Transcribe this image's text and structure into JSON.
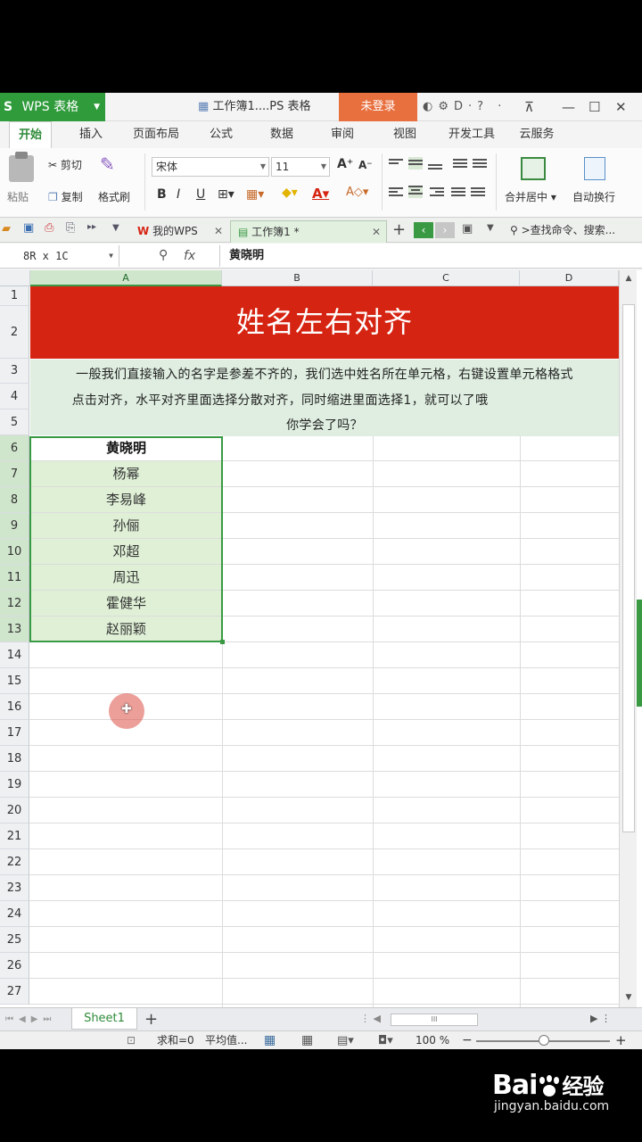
{
  "titlebar": {
    "app_logo": "S",
    "app_name": "WPS 表格",
    "doc_title": "工作簿1....PS 表格",
    "login": "未登录",
    "icons": [
      "skin-icon",
      "gear-icon",
      "cloud-icon",
      "help-icon"
    ],
    "help_text": "? ·"
  },
  "menu": {
    "tabs": [
      "开始",
      "插入",
      "页面布局",
      "公式",
      "数据",
      "审阅",
      "视图",
      "开发工具",
      "云服务"
    ]
  },
  "ribbon": {
    "paste": "粘贴",
    "cut": "剪切",
    "copy": "复制",
    "format_painter": "格式刷",
    "font_name": "宋体",
    "font_size": "11",
    "grow_font": "A⁺",
    "shrink_font": "A⁻",
    "bold": "B",
    "italic": "I",
    "underline": "U",
    "merge_center": "合并居中",
    "auto_wrap": "自动换行"
  },
  "tabbar": {
    "my_wps": "我的WPS",
    "workbook": "工作簿1 *",
    "search": "查找命令、搜索..."
  },
  "formula_bar": {
    "name_box": "8R x 1C",
    "fx": "fx",
    "content": "黄晓明"
  },
  "columns": [
    "A",
    "B",
    "C",
    "D"
  ],
  "rows": [
    "1",
    "2",
    "3",
    "4",
    "5",
    "6",
    "7",
    "8",
    "9",
    "10",
    "11",
    "12",
    "13",
    "14",
    "15",
    "16",
    "17",
    "18",
    "19",
    "20",
    "21",
    "22",
    "23",
    "24",
    "25",
    "26",
    "27"
  ],
  "sheet": {
    "title": "姓名左右对齐",
    "desc_line1": "一般我们直接输入的名字是参差不齐的，我们选中姓名所在单元格，右键设置单元格格式",
    "desc_line2": "点击对齐，水平对齐里面选择分散对齐，同时缩进里面选择1，就可以了哦",
    "desc_line3": "你学会了吗？",
    "names": [
      "黄晓明",
      "杨幂",
      "李易峰",
      "孙俪",
      "邓超",
      "周迅",
      "霍健华",
      "赵丽颖"
    ]
  },
  "sheet_tabs": {
    "active": "Sheet1",
    "add": "+"
  },
  "status": {
    "sum": "求和=0",
    "avg": "平均值...",
    "zoom": "100 %"
  },
  "watermark": {
    "brand": "Bai",
    "brand2": "经验",
    "url": "jingyan.baidu.com"
  },
  "colors": {
    "wps_green": "#2f9b3b",
    "login_orange": "#e8703f",
    "title_red": "#d62412",
    "desc_green": "#dfeee0",
    "selection_green": "#3a9a44"
  }
}
